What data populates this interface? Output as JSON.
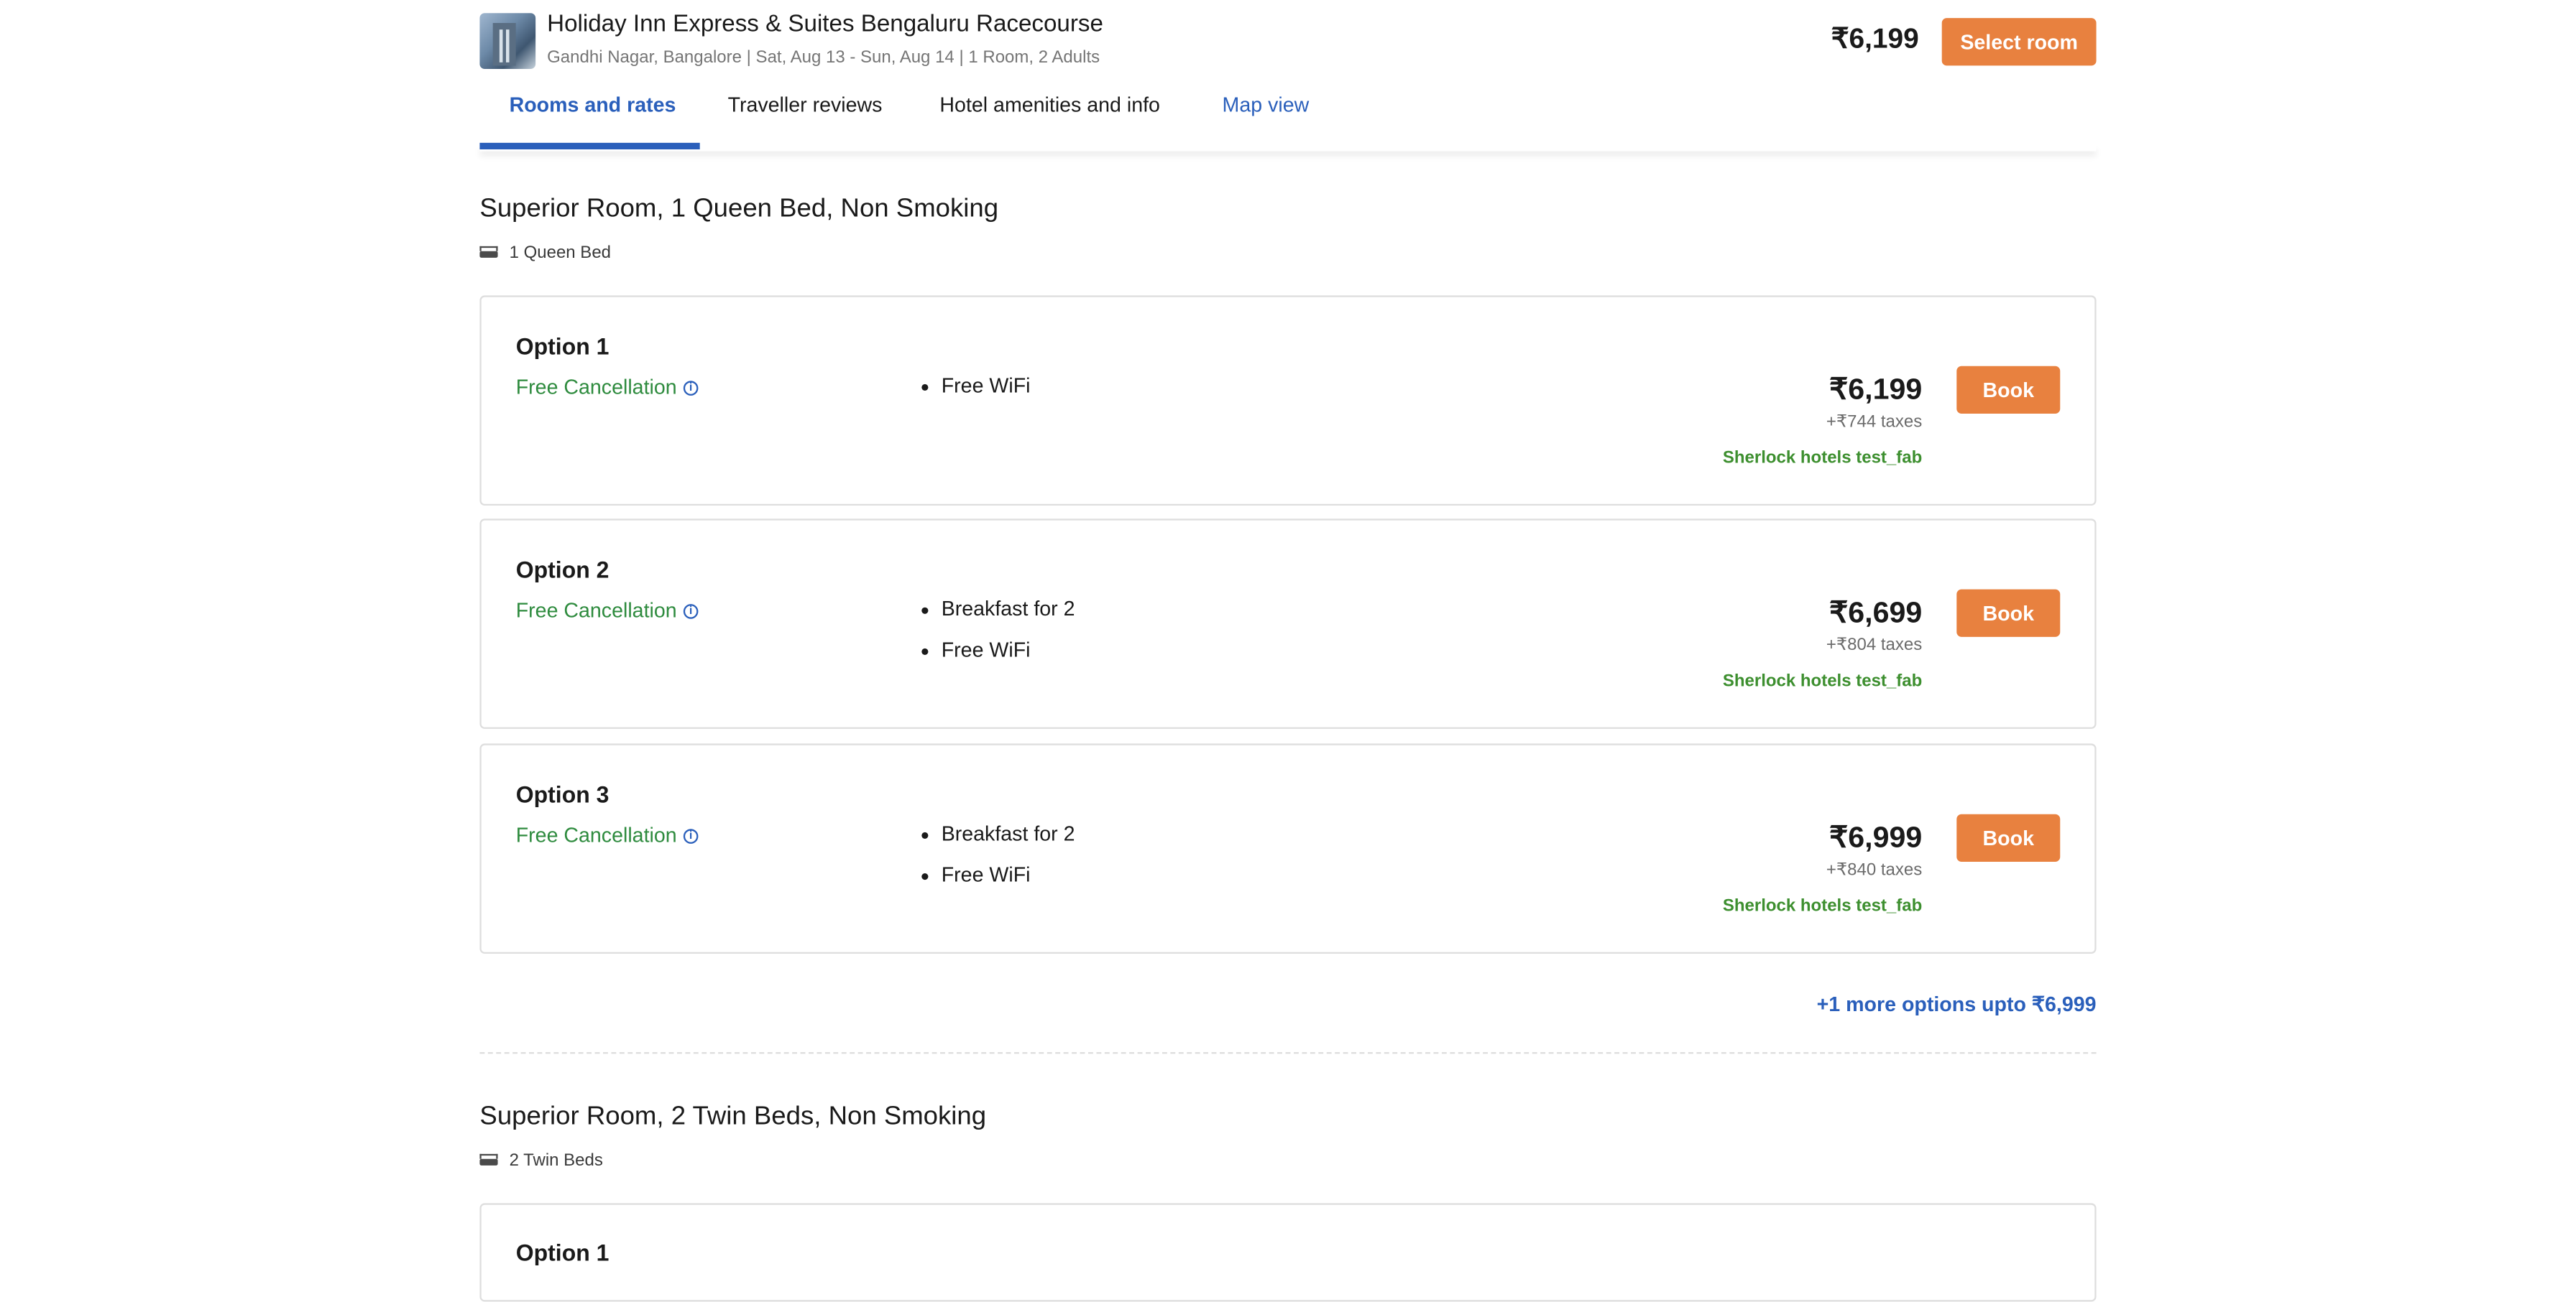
{
  "header": {
    "hotel_name": "Holiday Inn Express & Suites Bengaluru Racecourse",
    "meta": "Gandhi Nagar, Bangalore | Sat, Aug 13 - Sun, Aug 14 | 1 Room, 2 Adults",
    "price": "₹6,199",
    "select_label": "Select room",
    "thumb_icon": "hotel-photo"
  },
  "tabs": [
    {
      "label": "Rooms and rates"
    },
    {
      "label": "Traveller reviews"
    },
    {
      "label": "Hotel amenities and info"
    },
    {
      "label": "Map view"
    }
  ],
  "rooms": [
    {
      "title": "Superior Room, 1 Queen Bed, Non Smoking",
      "bed": "1 Queen Bed",
      "options": [
        {
          "title": "Option 1",
          "cancellation": "Free Cancellation",
          "amenities": [
            "Free WiFi"
          ],
          "price": "₹6,199",
          "taxes": "+₹744 taxes",
          "vendor": "Sherlock hotels test_fab",
          "book_label": "Book"
        },
        {
          "title": "Option 2",
          "cancellation": "Free Cancellation",
          "amenities": [
            "Breakfast for 2",
            "Free WiFi"
          ],
          "price": "₹6,699",
          "taxes": "+₹804 taxes",
          "vendor": "Sherlock hotels test_fab",
          "book_label": "Book"
        },
        {
          "title": "Option 3",
          "cancellation": "Free Cancellation",
          "amenities": [
            "Breakfast for 2",
            "Free WiFi"
          ],
          "price": "₹6,999",
          "taxes": "+₹840 taxes",
          "vendor": "Sherlock hotels test_fab",
          "book_label": "Book"
        }
      ],
      "more_options": "+1 more options upto ₹6,999"
    },
    {
      "title": "Superior Room, 2 Twin Beds, Non Smoking",
      "bed": "2 Twin Beds",
      "options": [
        {
          "title": "Option 1"
        }
      ]
    }
  ],
  "colors": {
    "accent": "#e8813f",
    "link": "#2a5fbb",
    "green": "#2e8b3e"
  }
}
